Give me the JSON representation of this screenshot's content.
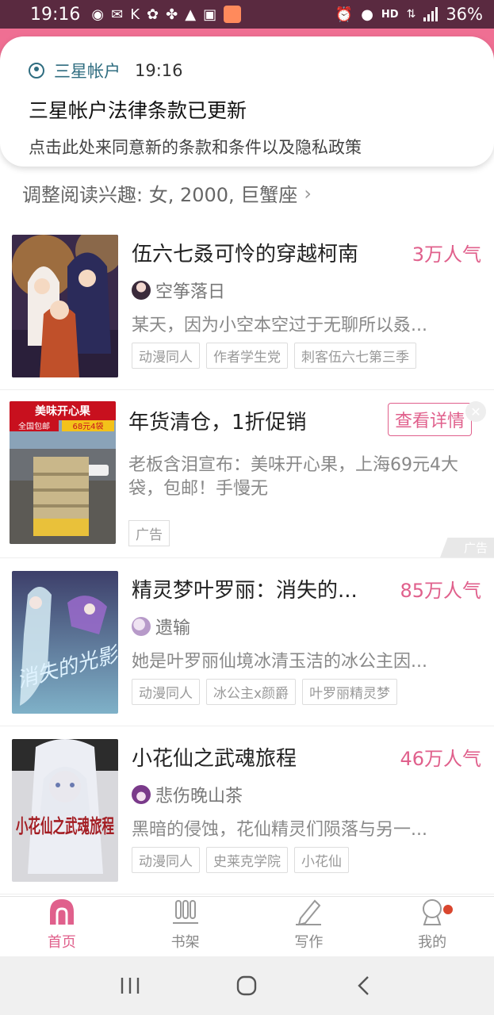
{
  "status_bar": {
    "time": "19:16",
    "network": "HD",
    "battery": "36%"
  },
  "notification": {
    "app": "三星帐户",
    "time": "19:16",
    "title": "三星帐户法律条款已更新",
    "body": "点击此处来同意新的条款和条件以及隐私政策"
  },
  "interest": {
    "label": "调整阅读兴趣: 女, 2000, 巨蟹座"
  },
  "books": [
    {
      "title": "伍六七叒可怜的穿越柯南",
      "popularity": "3万人气",
      "author": "空筝落日",
      "desc": "某天，因为小空本空过于无聊所以叒...",
      "tags": [
        "动漫同人",
        "作者学生党",
        "刺客伍六七第三季"
      ]
    },
    {
      "title": "精灵梦叶罗丽：消失的...",
      "popularity": "85万人气",
      "author": "遗输",
      "desc": "她是叶罗丽仙境冰清玉洁的冰公主因...",
      "tags": [
        "动漫同人",
        "冰公主x颜爵",
        "叶罗丽精灵梦"
      ]
    },
    {
      "title": "小花仙之武魂旅程",
      "popularity": "46万人气",
      "author": "悲伤晚山茶",
      "desc": "黑暗的侵蚀，花仙精灵们陨落与另一...",
      "tags": [
        "动漫同人",
        "史莱克学院",
        "小花仙"
      ]
    }
  ],
  "ad": {
    "title": "年货清仓，1折促销",
    "button": "查看详情",
    "desc": "老板含泪宣布：美味开心果，上海69元4大袋，包邮！手慢无",
    "tag": "广告",
    "mark": "广告",
    "image_banner": "美味开心果",
    "image_sub1": "全国包邮",
    "image_sub2": "68元4袋"
  },
  "cover_art": {
    "book3_title": "小花仙之武魂旅程",
    "book2_title": "消失的光影"
  },
  "bottom_nav": [
    {
      "label": "首页",
      "active": true
    },
    {
      "label": "书架",
      "active": false
    },
    {
      "label": "写作",
      "active": false
    },
    {
      "label": "我的",
      "active": false
    }
  ],
  "colors": {
    "accent": "#e0608c",
    "status_bar": "#5a2a40",
    "pink_band": "#ef6f93"
  }
}
